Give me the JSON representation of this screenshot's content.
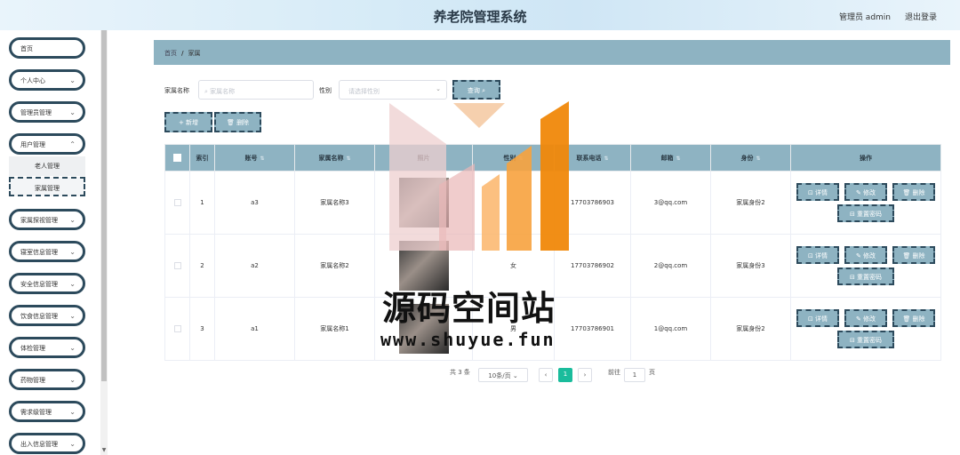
{
  "header": {
    "title": "养老院管理系统",
    "user": "管理员 admin",
    "logout": "退出登录"
  },
  "sidebar": {
    "items": [
      {
        "label": "首页"
      },
      {
        "label": "个人中心"
      },
      {
        "label": "管理员管理"
      },
      {
        "label": "用户管理"
      },
      {
        "label": "家属探视管理"
      },
      {
        "label": "寝室信息管理"
      },
      {
        "label": "安全信息管理"
      },
      {
        "label": "饮食信息管理"
      },
      {
        "label": "体检管理"
      },
      {
        "label": "药物管理"
      },
      {
        "label": "需求级管理"
      },
      {
        "label": "出入信息管理"
      }
    ],
    "sub_items": [
      {
        "label": "老人管理"
      },
      {
        "label": "家属管理"
      }
    ]
  },
  "breadcrumb": {
    "home": "首页",
    "sep": "/",
    "current": "家属"
  },
  "search": {
    "name_label": "家属名称",
    "name_placeholder": "家属名称",
    "gender_label": "性别",
    "gender_placeholder": "请选择性别",
    "query_label": "查询"
  },
  "toolbar": {
    "add_label": "新增",
    "delete_label": "删除"
  },
  "table": {
    "headers": [
      "索引",
      "账号",
      "家属名称",
      "照片",
      "性别",
      "联系电话",
      "邮箱",
      "身份",
      "操作"
    ],
    "rows": [
      {
        "index": "1",
        "account": "a3",
        "name": "家属名称3",
        "gender": "",
        "phone": "17703786903",
        "email": "3@qq.com",
        "identity": "家属身份2"
      },
      {
        "index": "2",
        "account": "a2",
        "name": "家属名称2",
        "gender": "女",
        "phone": "17703786902",
        "email": "2@qq.com",
        "identity": "家属身份3"
      },
      {
        "index": "3",
        "account": "a1",
        "name": "家属名称1",
        "gender": "男",
        "phone": "17703786901",
        "email": "1@qq.com",
        "identity": "家属身份2"
      }
    ],
    "ops": {
      "detail": "详情",
      "edit": "修改",
      "delete": "删除",
      "reset": "重置密码"
    }
  },
  "pagination": {
    "total": "共 3 条",
    "page_size": "10条/页",
    "current_page": "1",
    "goto_label": "前往",
    "goto_value": "1",
    "page_unit": "页"
  },
  "watermark": {
    "text": "源码空间站",
    "url": "www.shuyue.fun"
  },
  "colors": {
    "accent": "#8eb3c2",
    "border_dark": "#2c4a5c",
    "page_active": "#1abc9c"
  }
}
